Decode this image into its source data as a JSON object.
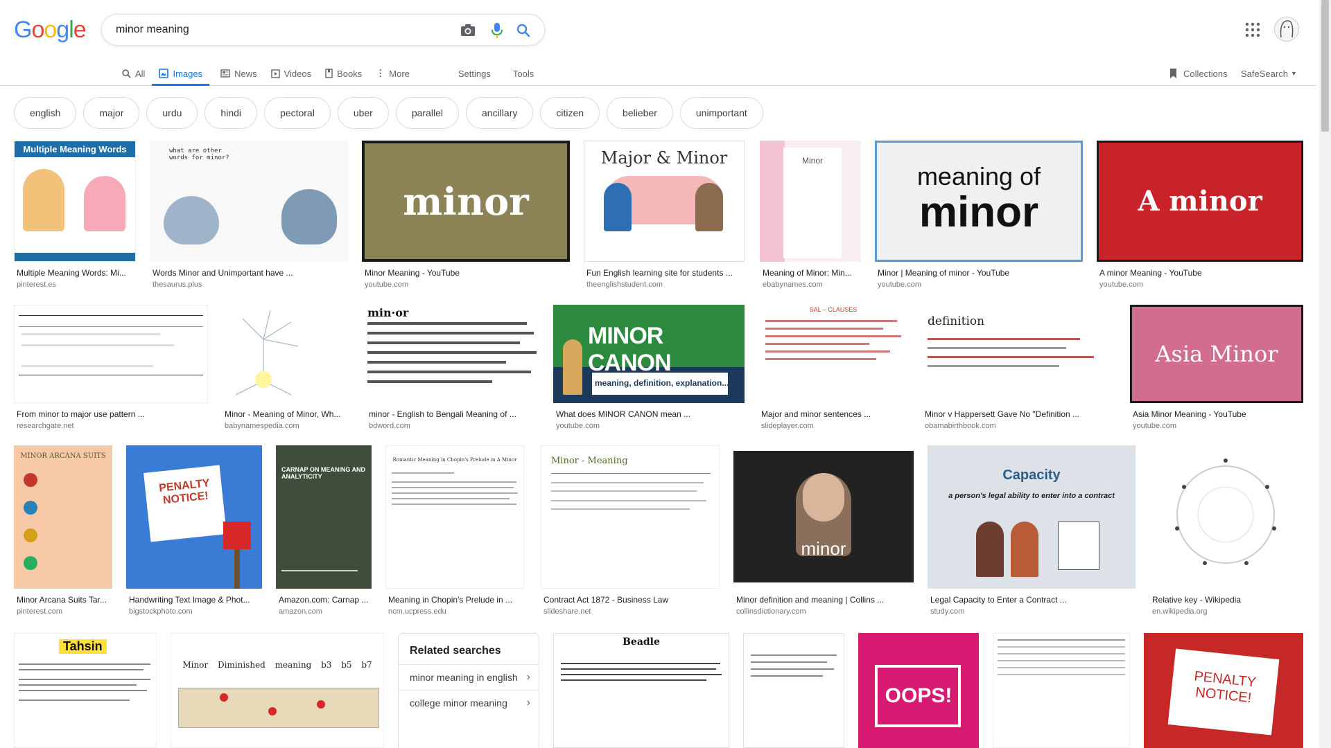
{
  "logo": {
    "text": "Google"
  },
  "search": {
    "value": "minor meaning"
  },
  "icons": {
    "camera": "camera-icon",
    "mic": "microphone-icon",
    "search": "search-icon",
    "apps": "apps-grid-icon",
    "collections": "bookmark-icon"
  },
  "tabs": [
    {
      "label": "All"
    },
    {
      "label": "Images"
    },
    {
      "label": "News"
    },
    {
      "label": "Videos"
    },
    {
      "label": "Books"
    },
    {
      "label": "More"
    }
  ],
  "tools": {
    "settings": "Settings",
    "tools": "Tools"
  },
  "right": {
    "collections": "Collections",
    "safesearch": "SafeSearch"
  },
  "chips": [
    "english",
    "major",
    "urdu",
    "hindi",
    "pectoral",
    "uber",
    "parallel",
    "ancillary",
    "citizen",
    "belieber",
    "unimportant"
  ],
  "results": [
    {
      "title": "Multiple Meaning Words: Mi...",
      "source": "pinterest.es",
      "text": "Multiple Meaning Words"
    },
    {
      "title": "Words Minor and Unimportant have ...",
      "source": "thesaurus.plus",
      "text": "what are other words for minor?"
    },
    {
      "title": "Minor Meaning - YouTube",
      "source": "youtube.com",
      "text": "minor"
    },
    {
      "title": "Fun English learning site for students ...",
      "source": "theenglishstudent.com",
      "text": "Major & Minor"
    },
    {
      "title": "Meaning of Minor: Min...",
      "source": "ebabynames.com",
      "text": "Minor"
    },
    {
      "title": "Minor | Meaning of minor - YouTube",
      "source": "youtube.com",
      "text": "meaning of",
      "text2": "minor"
    },
    {
      "title": "A minor Meaning - YouTube",
      "source": "youtube.com",
      "text": "A minor"
    },
    {
      "title": "From minor to major use pattern ...",
      "source": "researchgate.net"
    },
    {
      "title": "Minor - Meaning of Minor, Wh...",
      "source": "babynamespedia.com"
    },
    {
      "title": "minor - English to Bengali Meaning of ...",
      "source": "bdword.com",
      "text": "min·or"
    },
    {
      "title": "What does MINOR CANON mean ...",
      "source": "youtube.com",
      "text": "MINOR CANON",
      "text2": "meaning, definition, explanation..."
    },
    {
      "title": "Major and minor sentences ...",
      "source": "slideplayer.com",
      "text": "SAL – CLAUSES"
    },
    {
      "title": "Minor v Happersett Gave No \"Definition ...",
      "source": "obamabirthbook.com",
      "text": "definition"
    },
    {
      "title": "Asia Minor Meaning - YouTube",
      "source": "youtube.com",
      "text": "Asia Minor"
    },
    {
      "title": "Minor Arcana Suits Tar...",
      "source": "pinterest.com",
      "text": "MINOR ARCANA SUITS"
    },
    {
      "title": "Handwriting Text Image & Phot...",
      "source": "bigstockphoto.com",
      "text": "PENALTY NOTICE!"
    },
    {
      "title": "Amazon.com: Carnap ...",
      "source": "amazon.com",
      "text": "CARNAP ON MEANING AND ANALYTICITY"
    },
    {
      "title": "Meaning in Chopin's Prelude in ...",
      "source": "ncm.ucpress.edu",
      "text": "Romantic Meaning in Chopin's Prelude in A Minor"
    },
    {
      "title": "Contract Act 1872 - Business Law",
      "source": "slideshare.net",
      "text": "Minor - Meaning"
    },
    {
      "title": "Minor definition and meaning | Collins ...",
      "source": "collinsdictionary.com",
      "text": "minor"
    },
    {
      "title": "Legal Capacity to Enter a Contract ...",
      "source": "study.com",
      "text": "Capacity",
      "text2": "a person's legal ability to enter into a contract"
    },
    {
      "title": "Relative key - Wikipedia",
      "source": "en.wikipedia.org"
    },
    {
      "thumb_text": "Tahsin"
    },
    {
      "thumb_text": "Minor Diminished meaning b3 b5 b7"
    },
    {
      "thumb_text": "Beadle"
    },
    {
      "thumb_text": "OOPS!"
    },
    {
      "thumb_text": "PENALTY NOTICE!"
    }
  ],
  "related": {
    "heading": "Related searches",
    "items": [
      "minor meaning in english",
      "college minor meaning"
    ]
  }
}
